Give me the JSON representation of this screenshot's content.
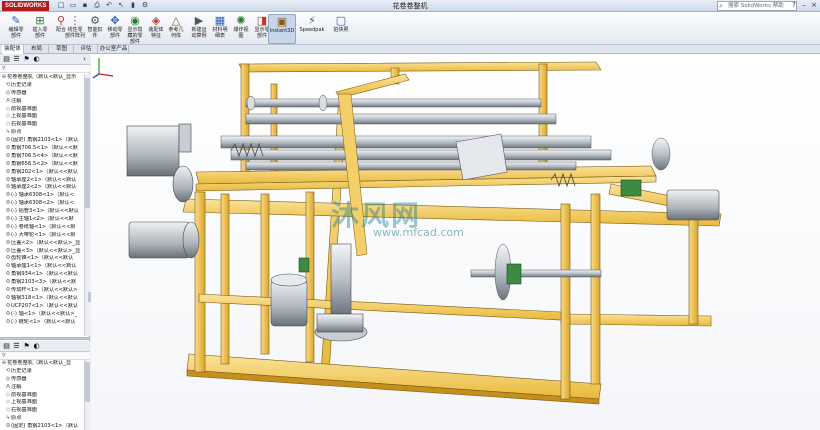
{
  "app": {
    "logo_text": "SOLIDWORKS",
    "document_title": "花卷卷整机",
    "search_placeholder": "搜索 SolidWorks 帮助",
    "accent_color": "#f5c542"
  },
  "quick_access": [
    "new-icon",
    "open-icon",
    "save-icon",
    "print-icon",
    "undo-icon",
    "select-icon",
    "rebuild-icon",
    "options-icon"
  ],
  "ribbon": {
    "buttons": [
      {
        "name": "edit-component-button",
        "icon": "edit-component-icon",
        "label": "编辑零\n部件"
      },
      {
        "name": "insert-components-button",
        "icon": "insert-component-icon",
        "label": "插入零\n部件"
      },
      {
        "name": "mate-button",
        "icon": "mate-icon",
        "label": "配合"
      },
      {
        "name": "linear-pattern-button",
        "icon": "pattern-icon",
        "label": "线性零\n部件阵列"
      },
      {
        "name": "smart-fasteners-button",
        "icon": "fastener-icon",
        "label": "智能扣\n件"
      },
      {
        "name": "move-component-button",
        "icon": "move-icon",
        "label": "移动零\n部件"
      },
      {
        "name": "show-hidden-button",
        "icon": "show-hidden-icon",
        "label": "显示隐\n藏的零\n部件"
      },
      {
        "name": "assembly-features-button",
        "icon": "assembly-feature-icon",
        "label": "装配体\n特征"
      },
      {
        "name": "reference-geometry-button",
        "icon": "reference-geometry-icon",
        "label": "参考几\n何体"
      },
      {
        "name": "new-motion-study-button",
        "icon": "motion-study-icon",
        "label": "新建运\n动算例"
      },
      {
        "name": "bill-of-materials-button",
        "icon": "bom-icon",
        "label": "材料明\n细表"
      },
      {
        "name": "exploded-view-button",
        "icon": "explode-icon",
        "label": "爆炸视\n图"
      },
      {
        "name": "instant3d-button",
        "icon": "instant3d-icon",
        "label": "显示零\n部件"
      },
      {
        "name": "instant3d-toggle-button",
        "icon": "instant3d-toggle-icon",
        "label": "Instant3D"
      },
      {
        "name": "speedpak-button",
        "icon": "speedpak-icon",
        "label": "Speedpak"
      },
      {
        "name": "snapshot-button",
        "icon": "snapshot-icon",
        "label": "拍快照"
      }
    ]
  },
  "tabs": [
    {
      "label": "装配体",
      "active": true
    },
    {
      "label": "布局",
      "active": false
    },
    {
      "label": "草图",
      "active": false
    },
    {
      "label": "评估",
      "active": false
    },
    {
      "label": "办公室产品",
      "active": false
    }
  ],
  "tree_top": [
    {
      "icon": "assembly-icon",
      "label": "花卷卷整机（默认<默认_显示"
    },
    {
      "icon": "history-icon",
      "label": "历史记录"
    },
    {
      "icon": "sensor-icon",
      "label": "传感器"
    },
    {
      "icon": "annotation-icon",
      "label": "注解"
    },
    {
      "icon": "plane-icon",
      "label": "前视基准面"
    },
    {
      "icon": "plane-icon",
      "label": "上视基准面"
    },
    {
      "icon": "plane-icon",
      "label": "右视基准面"
    },
    {
      "icon": "origin-icon",
      "label": "原点"
    },
    {
      "icon": "part-icon",
      "label": "(固定) 角钢2103<1>（默认"
    },
    {
      "icon": "part-icon",
      "label": "角钢706.5<1>（默认<<默"
    },
    {
      "icon": "part-icon",
      "label": "角钢706.5<4>（默认<<默"
    },
    {
      "icon": "part-icon",
      "label": "角钢656.5<2>（默认<<默"
    },
    {
      "icon": "part-icon",
      "label": "角钢202<1>（默认<<默认"
    },
    {
      "icon": "part-icon",
      "label": "轴承座2<1>（默认<<默认"
    },
    {
      "icon": "part-icon",
      "label": "轴承座2<2>（默认<<默认"
    },
    {
      "icon": "part-icon",
      "label": "(-) 轴承6308<1>（默认<"
    },
    {
      "icon": "part-icon",
      "label": "(-) 轴承6308<2>（默认<"
    },
    {
      "icon": "part-icon",
      "label": "(-) 铝管3<1>（默认<<默认"
    },
    {
      "icon": "part-icon",
      "label": "(-) 主轴1<2>（默认<<默"
    },
    {
      "icon": "part-icon",
      "label": "(-) 卷纸轴<1>（默认<<默"
    },
    {
      "icon": "part-icon",
      "label": "(-) 大带轮<1>（默认<<默"
    },
    {
      "icon": "part-icon",
      "label": "压盖<2>（默认<<默认>_显"
    },
    {
      "icon": "part-icon",
      "label": "压盖<3>（默认<<默认>_显"
    },
    {
      "icon": "part-icon",
      "label": "齿轮锥<1>（默认<<默认"
    },
    {
      "icon": "part-icon",
      "label": "轴承座1<1>（默认<<默认"
    },
    {
      "icon": "part-icon",
      "label": "角钢934<1>（默认<<默认"
    },
    {
      "icon": "part-icon",
      "label": "角钢2103<3>（默认<<默"
    },
    {
      "icon": "part-icon",
      "label": "传动杆<1>（默认<<默认>"
    },
    {
      "icon": "part-icon",
      "label": "轴钢318<1>（默认<<默认"
    },
    {
      "icon": "part-icon",
      "label": "UCP207<1>（默认<<默认"
    },
    {
      "icon": "part-icon",
      "label": "(-) 轴<1>（默认<<默认>_"
    },
    {
      "icon": "part-icon",
      "label": "(-) 链轮<1>（默认<<默认"
    }
  ],
  "tree_bottom": [
    {
      "icon": "assembly-icon",
      "label": "花卷卷整机（默认<默认_显"
    },
    {
      "icon": "history-icon",
      "label": "历史记录"
    },
    {
      "icon": "sensor-icon",
      "label": "传感器"
    },
    {
      "icon": "annotation-icon",
      "label": "注解"
    },
    {
      "icon": "plane-icon",
      "label": "前视基准面"
    },
    {
      "icon": "plane-icon",
      "label": "上视基准面"
    },
    {
      "icon": "plane-icon",
      "label": "右视基准面"
    },
    {
      "icon": "origin-icon",
      "label": "原点"
    },
    {
      "icon": "part-icon",
      "label": "(固定) 角钢2103<1>（默认"
    }
  ],
  "watermark": {
    "text": "沐风网",
    "url": "www.mfcad.com"
  }
}
